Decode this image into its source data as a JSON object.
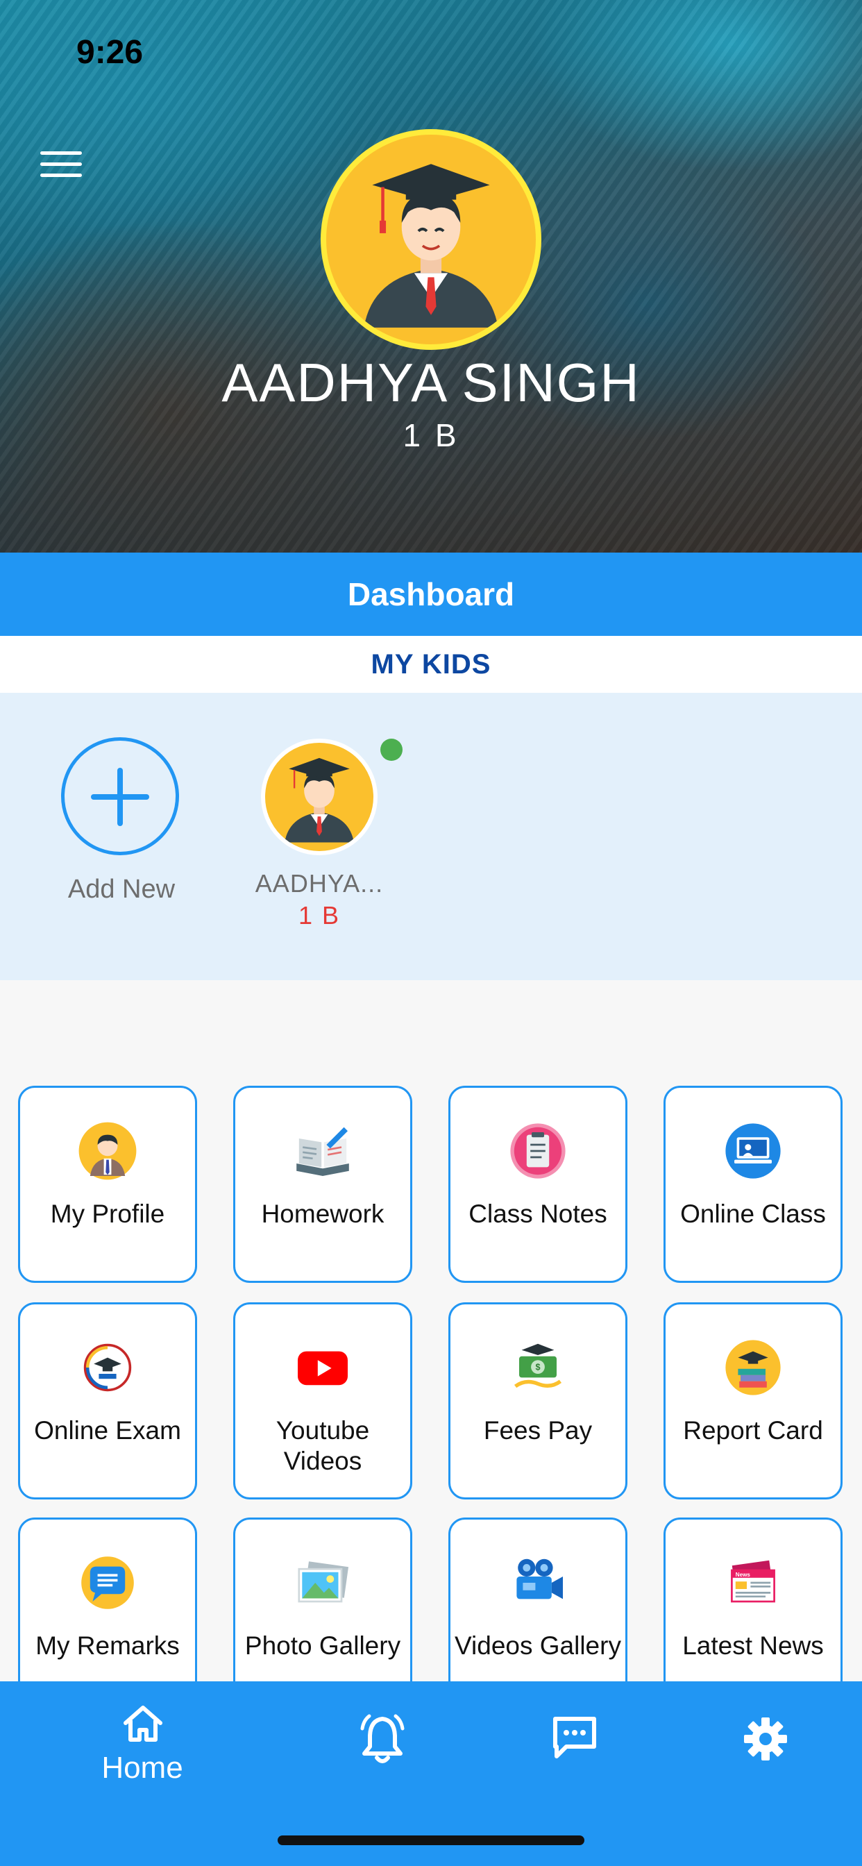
{
  "status_bar": {
    "time": "9:26"
  },
  "header": {
    "student_name": "AADHYA SINGH",
    "student_class": "1 B"
  },
  "dashboard": {
    "title": "Dashboard"
  },
  "my_kids": {
    "title": "MY KIDS",
    "add_label": "Add New",
    "kids": [
      {
        "name": "AADHYA...",
        "class": "1 B"
      }
    ]
  },
  "tiles": [
    {
      "label": "My Profile",
      "icon": "profile-icon"
    },
    {
      "label": "Homework",
      "icon": "homework-icon"
    },
    {
      "label": "Class Notes",
      "icon": "class-notes-icon"
    },
    {
      "label": "Online Class",
      "icon": "online-class-icon"
    },
    {
      "label": "Online Exam",
      "icon": "online-exam-icon"
    },
    {
      "label": "Youtube Videos",
      "icon": "youtube-icon"
    },
    {
      "label": "Fees Pay",
      "icon": "fees-pay-icon"
    },
    {
      "label": "Report Card",
      "icon": "report-card-icon"
    },
    {
      "label": "My Remarks",
      "icon": "remarks-icon"
    },
    {
      "label": "Photo Gallery",
      "icon": "photo-gallery-icon"
    },
    {
      "label": "Videos Gallery",
      "icon": "video-camera-icon"
    },
    {
      "label": "Latest News",
      "icon": "news-icon"
    }
  ],
  "bottom_nav": {
    "home_label": "Home",
    "items": [
      "home-icon",
      "bell-icon",
      "chat-icon",
      "settings-icon"
    ]
  },
  "colors": {
    "primary": "#2196f3",
    "kids_bg": "#e3f0fb",
    "accent_red": "#e53935",
    "online_green": "#4caf50"
  }
}
